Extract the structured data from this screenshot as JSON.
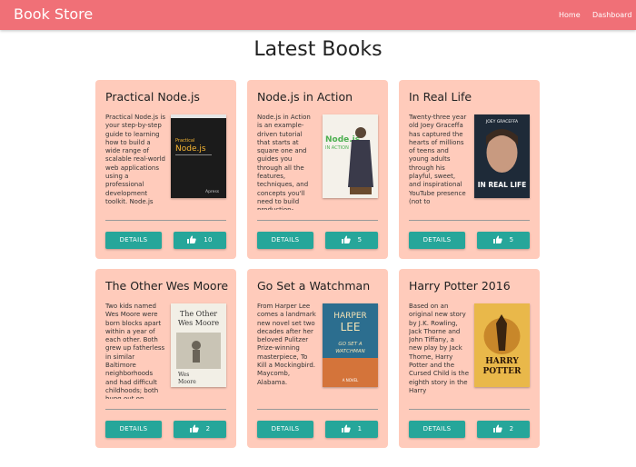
{
  "nav": {
    "brand": "Book Store",
    "links": [
      "Home",
      "Dashboard"
    ]
  },
  "page": {
    "title": "Latest Books"
  },
  "colors": {
    "navbar": "#f07077",
    "card": "#ffcbbb",
    "button": "#26a69a"
  },
  "books": [
    {
      "title": "Practical Node.js",
      "description": "Practical Node.js is your step-by-step guide to learning how to build a wide range of scalable real-world web applications using a professional development toolkit. Node.js",
      "details_label": "DETAILS",
      "likes": "10",
      "cover_icon": "book-cover-practical-nodejs",
      "cover_text": [
        "Practical",
        "Node.js",
        "Apress"
      ]
    },
    {
      "title": "Node.js in Action",
      "description": "Node.js in Action is an example-driven tutorial that starts at square one and guides you through all the features, techniques, and concepts you'll need to build production-",
      "details_label": "DETAILS",
      "likes": "5",
      "cover_icon": "book-cover-nodejs-in-action",
      "cover_text": [
        "Node.js",
        "IN ACTION"
      ]
    },
    {
      "title": "In Real Life",
      "description": "Twenty-three year old Joey Graceffa has captured the hearts of millions of teens and young adults through his playful, sweet, and inspirational YouTube presence (not to",
      "details_label": "DETAILS",
      "likes": "5",
      "cover_icon": "book-cover-in-real-life",
      "cover_text": [
        "JOEY GRACEFFA",
        "IN REAL LIFE"
      ]
    },
    {
      "title": "The Other Wes Moore",
      "description": "Two kids named Wes Moore were born blocks apart within a year of each other. Both grew up fatherless in similar Baltimore neighborhoods and had difficult childhoods; both hung out on",
      "details_label": "DETAILS",
      "likes": "2",
      "cover_icon": "book-cover-the-other-wes-moore",
      "cover_text": [
        "The Other",
        "Wes Moore",
        "Wes",
        "Moore"
      ]
    },
    {
      "title": "Go Set a Watchman",
      "description": "From Harper Lee comes a landmark new novel set two decades after her beloved Pulitzer Prize-winning masterpiece, To Kill a Mockingbird. Maycomb, Alabama.",
      "details_label": "DETAILS",
      "likes": "1",
      "cover_icon": "book-cover-go-set-a-watchman",
      "cover_text": [
        "HARPER",
        "LEE",
        "GO SET A",
        "WATCHMAN",
        "A NOVEL"
      ]
    },
    {
      "title": "Harry Potter 2016",
      "description": "Based on an original new story by J.K. Rowling, Jack Thorne and John Tiffany, a new play by Jack Thorne, Harry Potter and the Cursed Child is the eighth story in the Harry",
      "details_label": "DETAILS",
      "likes": "2",
      "cover_icon": "book-cover-harry-potter-cursed-child",
      "cover_text": [
        "HARRY",
        "POTTER"
      ]
    }
  ]
}
